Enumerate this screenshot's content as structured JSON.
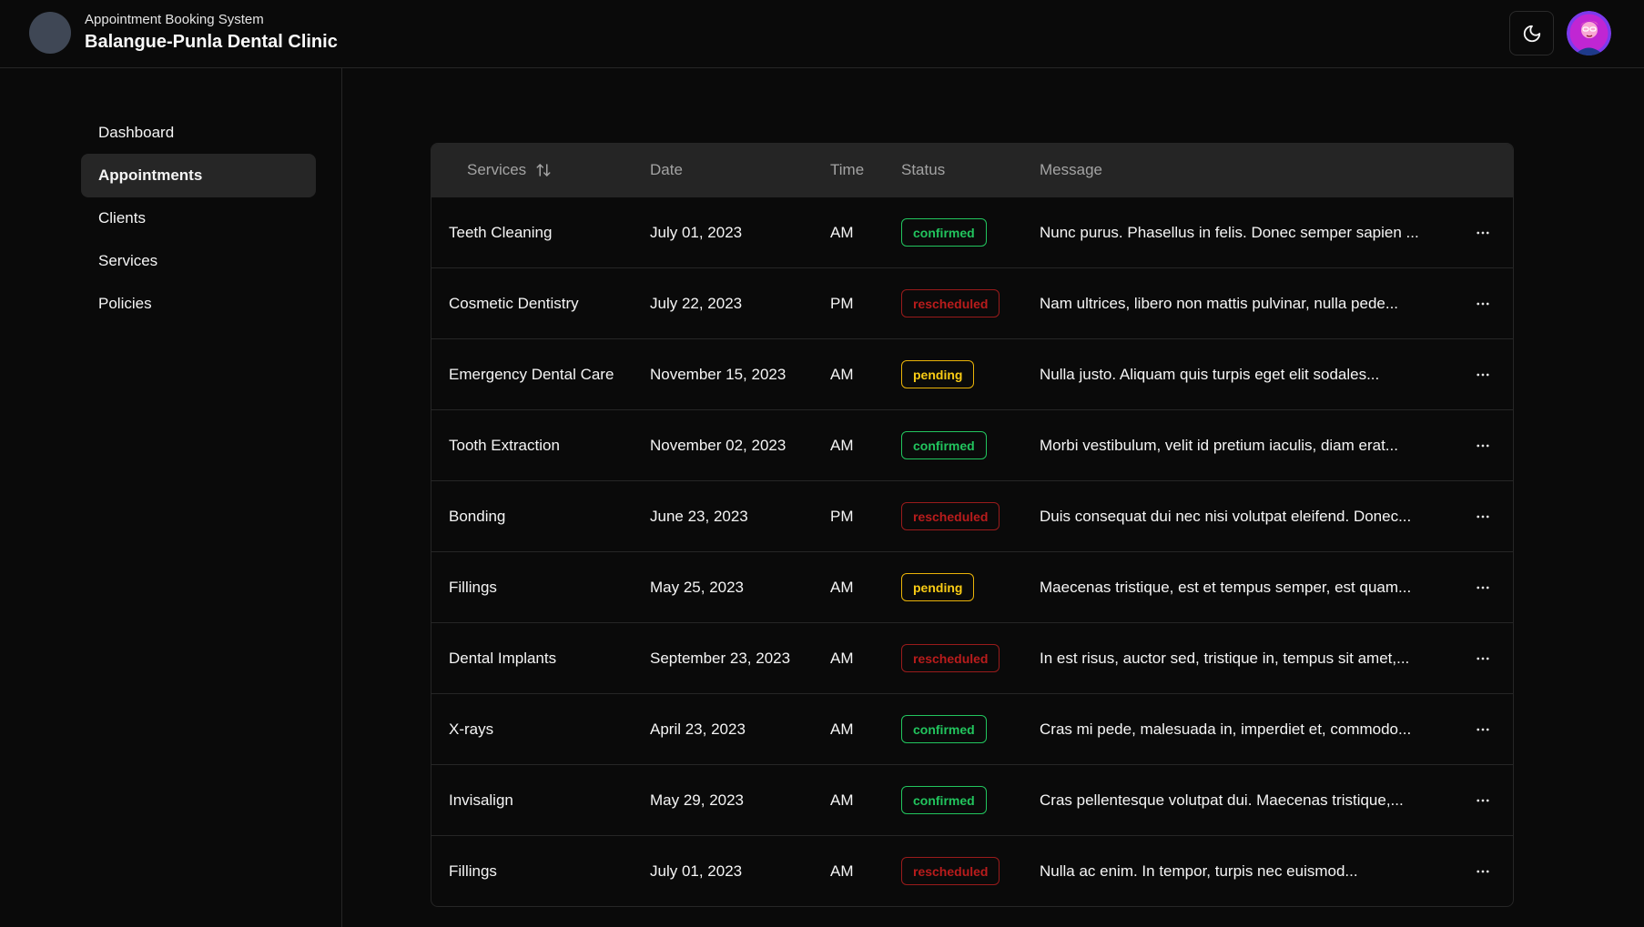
{
  "header": {
    "subtitle": "Appointment Booking System",
    "title": "Balangue-Punla Dental Clinic",
    "theme_icon": "moon-icon"
  },
  "sidebar": {
    "items": [
      {
        "label": "Dashboard",
        "active": false
      },
      {
        "label": "Appointments",
        "active": true
      },
      {
        "label": "Clients",
        "active": false
      },
      {
        "label": "Services",
        "active": false
      },
      {
        "label": "Policies",
        "active": false
      }
    ]
  },
  "table": {
    "columns": [
      "Services",
      "Date",
      "Time",
      "Status",
      "Message"
    ],
    "sort_icon": "sort-arrows-icon",
    "rows": [
      {
        "service": "Teeth Cleaning",
        "date": "July 01, 2023",
        "time": "AM",
        "status": "confirmed",
        "message": "Nunc purus. Phasellus in felis. Donec semper sapien ..."
      },
      {
        "service": "Cosmetic Dentistry",
        "date": "July 22, 2023",
        "time": "PM",
        "status": "rescheduled",
        "message": "Nam ultrices, libero non mattis pulvinar, nulla pede..."
      },
      {
        "service": "Emergency Dental Care",
        "date": "November 15, 2023",
        "time": "AM",
        "status": "pending",
        "message": "Nulla justo. Aliquam quis turpis eget elit sodales..."
      },
      {
        "service": "Tooth Extraction",
        "date": "November 02, 2023",
        "time": "AM",
        "status": "confirmed",
        "message": "Morbi vestibulum, velit id pretium iaculis, diam erat..."
      },
      {
        "service": "Bonding",
        "date": "June 23, 2023",
        "time": "PM",
        "status": "rescheduled",
        "message": "Duis consequat dui nec nisi volutpat eleifend. Donec..."
      },
      {
        "service": "Fillings",
        "date": "May 25, 2023",
        "time": "AM",
        "status": "pending",
        "message": "Maecenas tristique, est et tempus semper, est quam..."
      },
      {
        "service": "Dental Implants",
        "date": "September 23, 2023",
        "time": "AM",
        "status": "rescheduled",
        "message": "In est risus, auctor sed, tristique in, tempus sit amet,..."
      },
      {
        "service": "X-rays",
        "date": "April 23, 2023",
        "time": "AM",
        "status": "confirmed",
        "message": "Cras mi pede, malesuada in, imperdiet et, commodo..."
      },
      {
        "service": "Invisalign",
        "date": "May 29, 2023",
        "time": "AM",
        "status": "confirmed",
        "message": "Cras pellentesque volutpat dui. Maecenas tristique,..."
      },
      {
        "service": "Fillings",
        "date": "July 01, 2023",
        "time": "AM",
        "status": "rescheduled",
        "message": "Nulla ac enim. In tempor, turpis nec euismod..."
      }
    ]
  },
  "colors": {
    "background": "#0a0a0a",
    "confirmed": "#22c55e",
    "rescheduled": "#b91c1c",
    "pending": "#facc15"
  }
}
